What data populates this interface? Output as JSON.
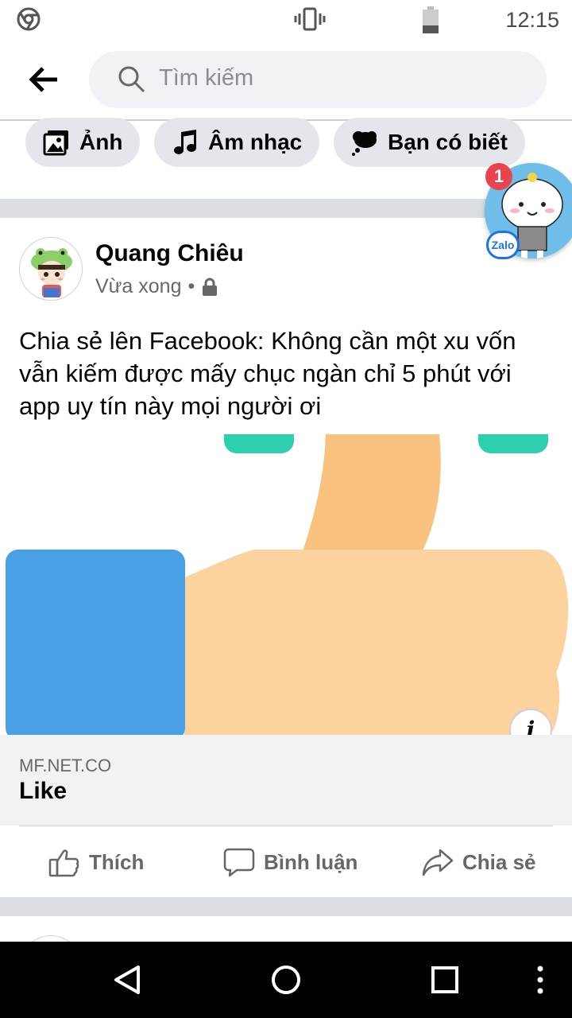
{
  "status_bar": {
    "time": "12:15"
  },
  "search": {
    "placeholder": "Tìm kiếm"
  },
  "chips": [
    {
      "label": "Ảnh",
      "icon": "photo-icon"
    },
    {
      "label": "Âm nhạc",
      "icon": "music-note-icon"
    },
    {
      "label": "Bạn có biết",
      "icon": "thought-bubble-icon"
    }
  ],
  "zalo": {
    "badge_count": "1",
    "logo_text": "Zalo"
  },
  "post": {
    "author": "Quang Chiêu",
    "time": "Vừa xong",
    "separator": "•",
    "privacy_icon": "lock-icon",
    "text": "Chia sẻ lên Facebook: Không cần một xu vốn vẫn kiếm được mấy chục ngàn chỉ 5 phút với app uy tín này mọi người ơi",
    "link": {
      "domain": "MF.NET.CO",
      "title": "Like",
      "info": "i"
    },
    "actions": {
      "like": "Thích",
      "comment": "Bình luận",
      "share": "Chia sẻ"
    }
  },
  "colors": {
    "accent": "#1877f2",
    "thumb_blue": "#4aa0e6",
    "thumb_skin": "#fcd29f",
    "mint": "#2ecfad"
  }
}
